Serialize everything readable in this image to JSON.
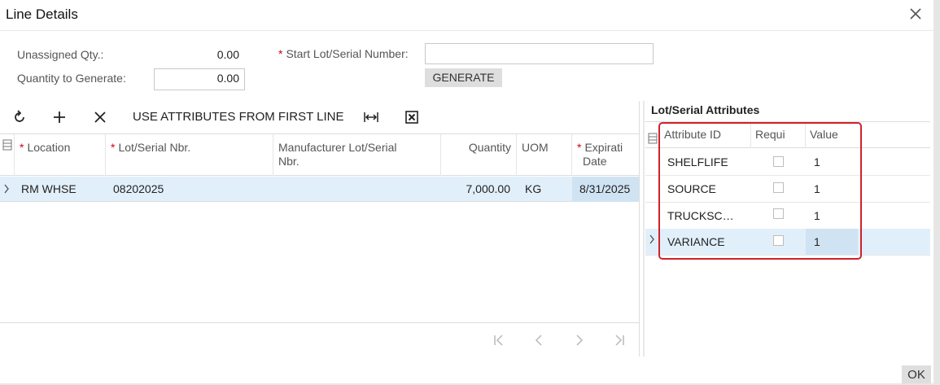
{
  "dialog": {
    "title": "Line Details",
    "close_icon": "close-icon",
    "ok_label": "OK"
  },
  "form": {
    "unassigned_qty_label": "Unassigned Qty.:",
    "unassigned_qty_value": "0.00",
    "qty_to_generate_label": "Quantity to Generate:",
    "qty_to_generate_value": "0.00",
    "start_lot_label": "Start Lot/Serial Number:",
    "start_lot_value": "",
    "generate_label": "GENERATE"
  },
  "toolbar": {
    "refresh_icon": "refresh-icon",
    "add_icon": "add-icon",
    "delete_icon": "delete-icon",
    "use_attributes_label": "USE ATTRIBUTES FROM FIRST LINE",
    "fit_columns_icon": "fit-columns-icon",
    "export_icon": "export-excel-icon"
  },
  "lines_grid": {
    "columns": {
      "location": "Location",
      "lot_serial": "Lot/Serial Nbr.",
      "mfr_lot_line1": "Manufacturer Lot/Serial",
      "mfr_lot_line2": "Nbr.",
      "quantity": "Quantity",
      "uom": "UOM",
      "expiration_line1": "Expirati",
      "expiration_line2": "Date"
    },
    "rows": [
      {
        "location": "RM WHSE",
        "lot_serial": "08202025",
        "mfr_lot": "",
        "quantity": "7,000.00",
        "uom": "KG",
        "expiration": "8/31/2025"
      }
    ]
  },
  "attributes_panel": {
    "title": "Lot/Serial Attributes",
    "columns": {
      "attribute_id": "Attribute ID",
      "required": "Requi",
      "value": "Value"
    },
    "rows": [
      {
        "attribute_id": "SHELFLIFE",
        "required": false,
        "value": "1"
      },
      {
        "attribute_id": "SOURCE",
        "required": false,
        "value": "1"
      },
      {
        "attribute_id": "TRUCKSC…",
        "required": false,
        "value": "1"
      },
      {
        "attribute_id": "VARIANCE",
        "required": false,
        "value": "1"
      }
    ]
  },
  "colors": {
    "required_marker": "#d0021b",
    "selected_row": "#e1effa",
    "highlight_box": "#d0222b"
  }
}
